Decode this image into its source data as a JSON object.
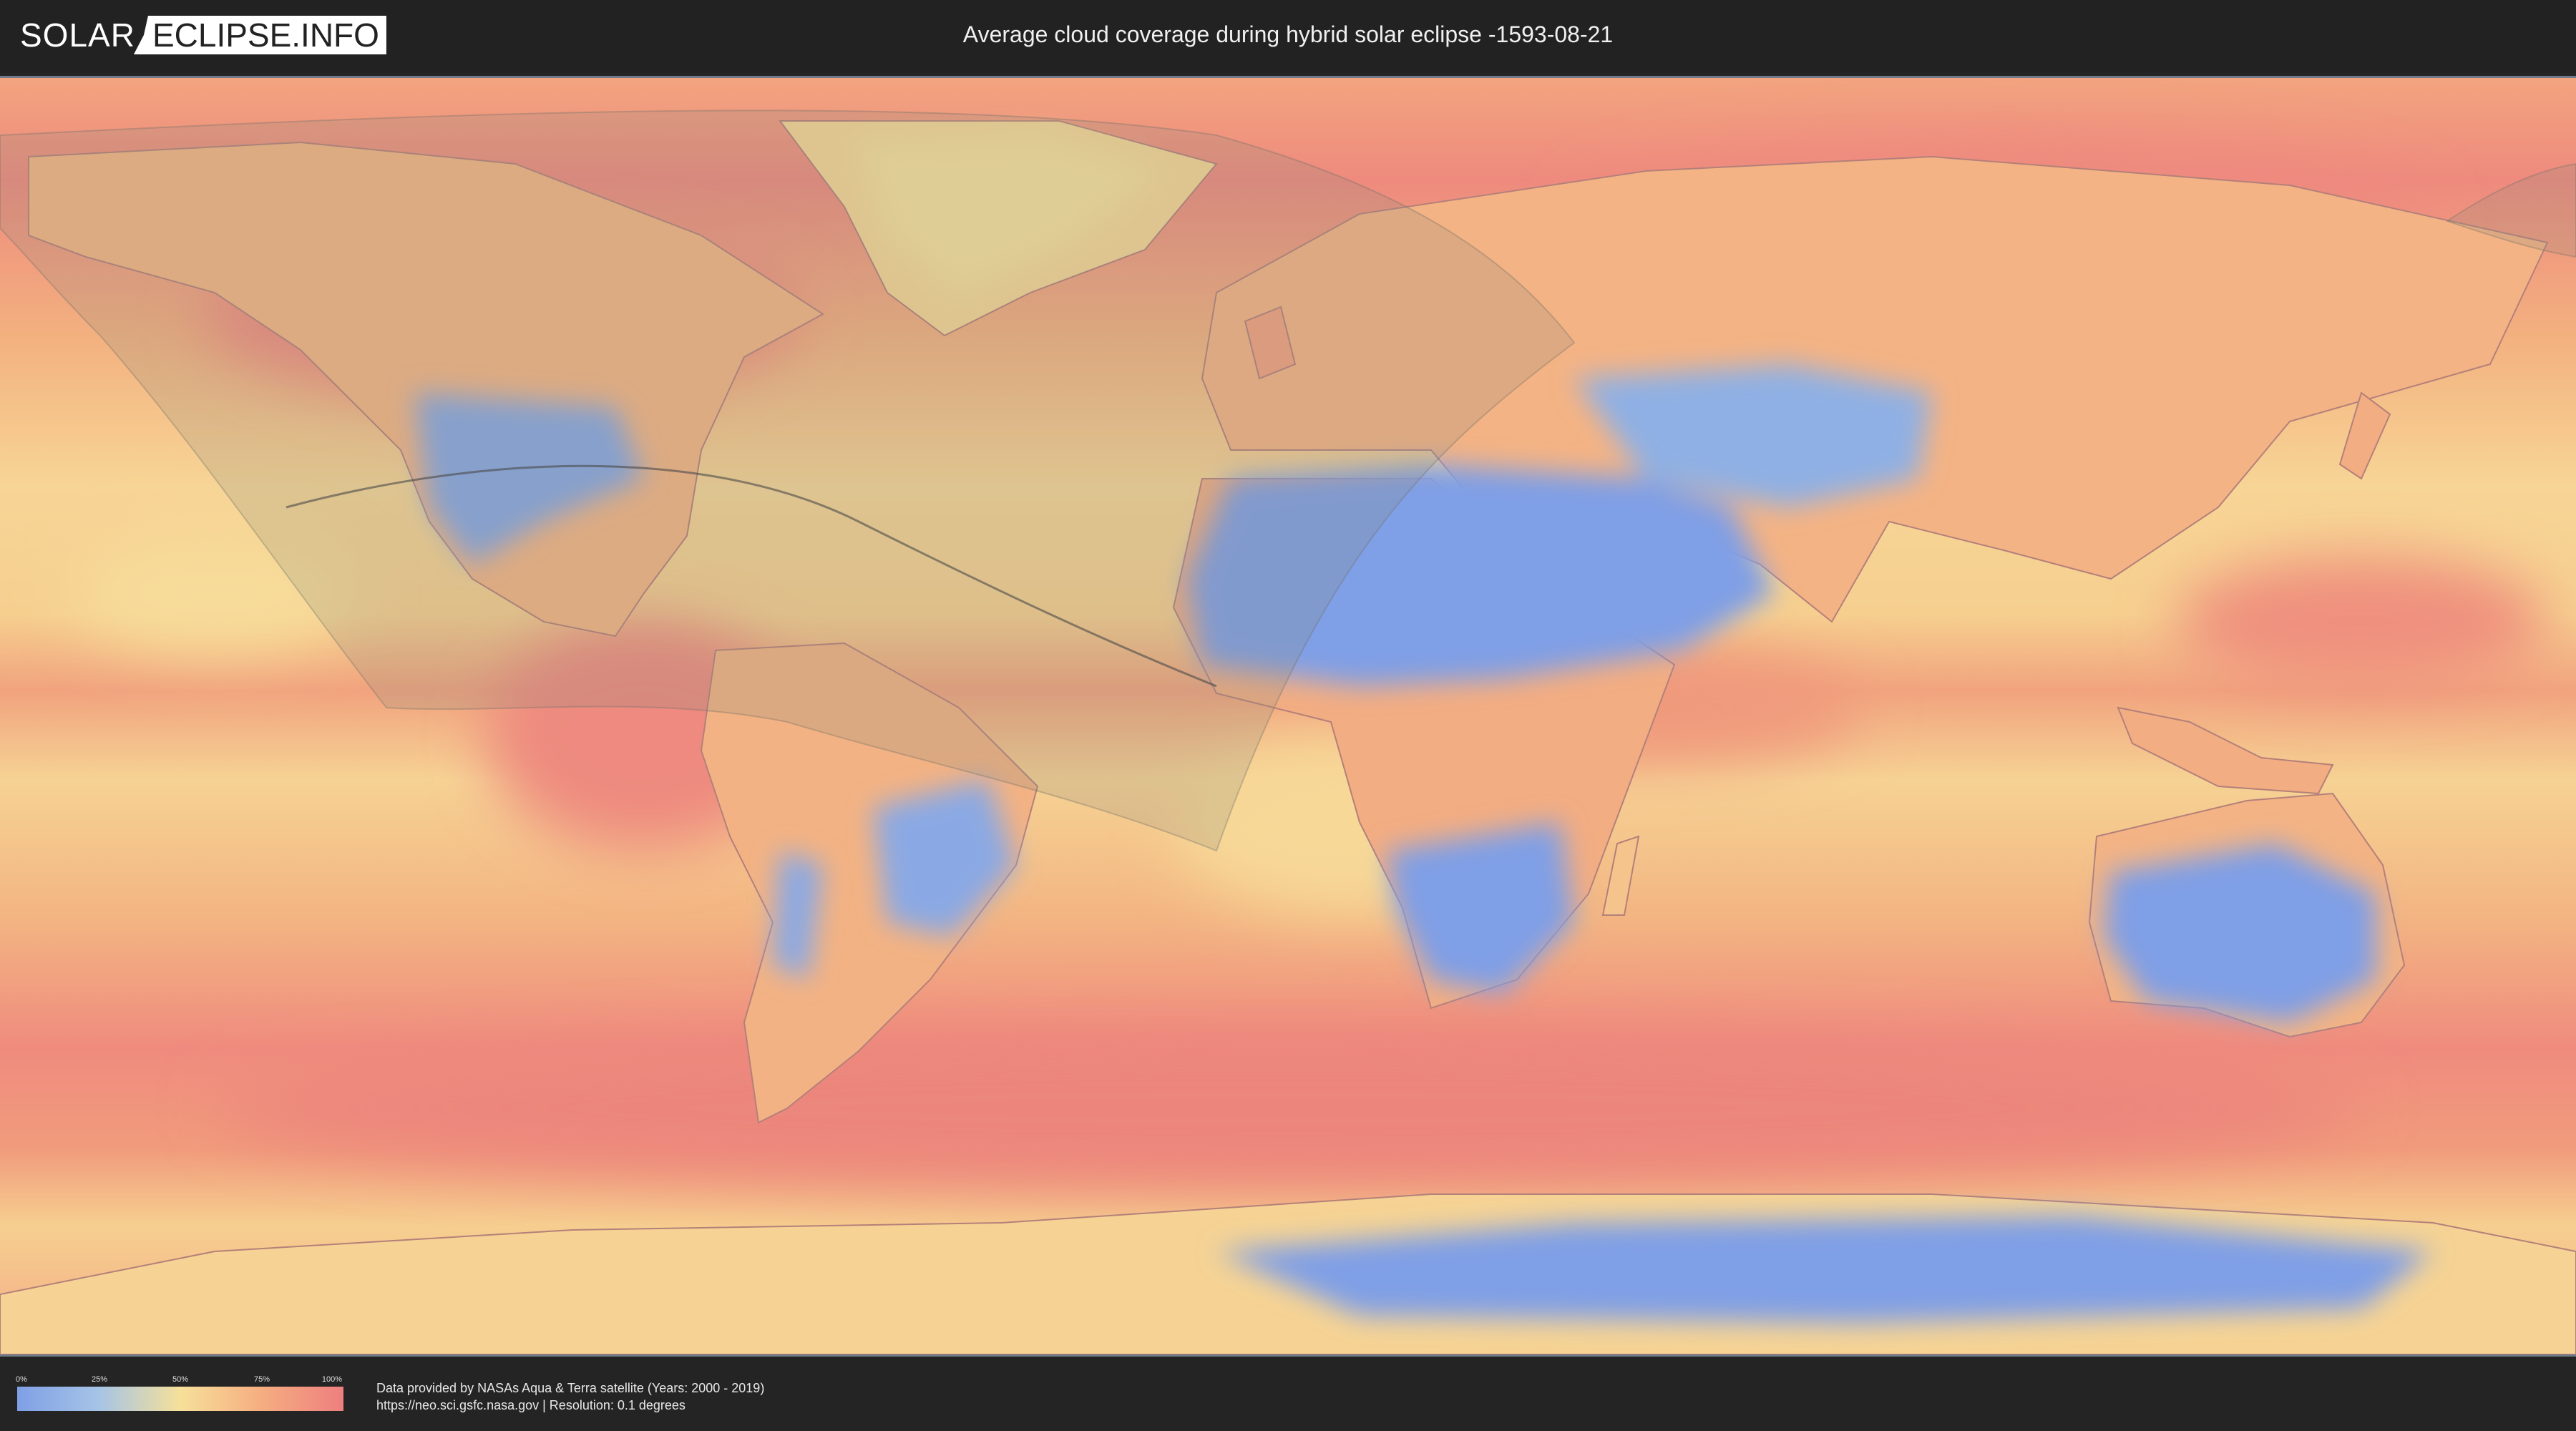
{
  "header": {
    "logo_left": "SOLAR",
    "logo_right": "ECLIPSE.INFO",
    "title": "Average cloud coverage during hybrid solar eclipse -1593-08-21"
  },
  "legend": {
    "ticks": [
      "0%",
      "25%",
      "50%",
      "75%",
      "100%"
    ],
    "colors": [
      "#7f9fe6",
      "#a6c4e6",
      "#f6e09a",
      "#f5ad80",
      "#ee7f7f"
    ]
  },
  "credits": {
    "line1": "Data provided by NASAs Aqua & Terra satellite (Years: 2000 - 2019)",
    "line2": "https://neo.sci.gsfc.nasa.gov | Resolution: 0.1 degrees"
  },
  "colors": {
    "clear": "#7f9fe6",
    "cloudy": "#ee7f7f",
    "mid": "#f6e09a",
    "shadow_overlay": "#8a8a7a"
  }
}
